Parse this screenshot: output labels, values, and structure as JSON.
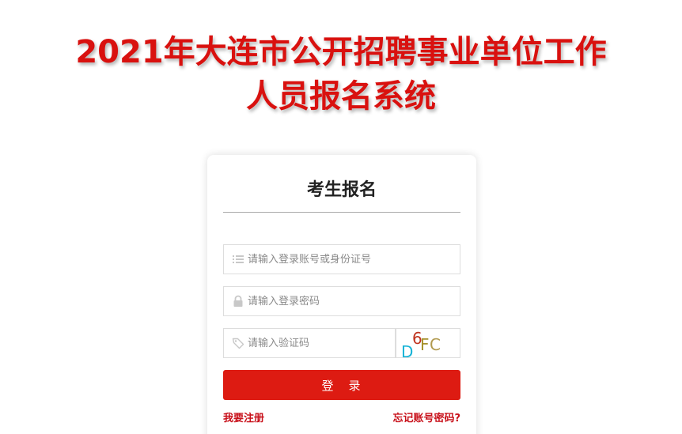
{
  "header": {
    "title_line1": "2021年大连市公开招聘事业单位工作",
    "title_line2": "人员报名系统"
  },
  "login": {
    "title": "考生报名",
    "account": {
      "placeholder": "请输入登录账号或身份证号",
      "icon": "list-icon"
    },
    "password": {
      "placeholder": "请输入登录密码",
      "icon": "lock-icon"
    },
    "captcha": {
      "placeholder": "请输入验证码",
      "icon": "tag-icon"
    },
    "captcha_chars": [
      "D",
      "6",
      "F",
      "C"
    ],
    "submit_label": "登　录",
    "register_link": "我要注册",
    "forgot_link": "忘记账号密码?"
  },
  "colors": {
    "title_red": "#d9110f",
    "button_red": "#dd1b12",
    "link_red": "#c8101a"
  }
}
